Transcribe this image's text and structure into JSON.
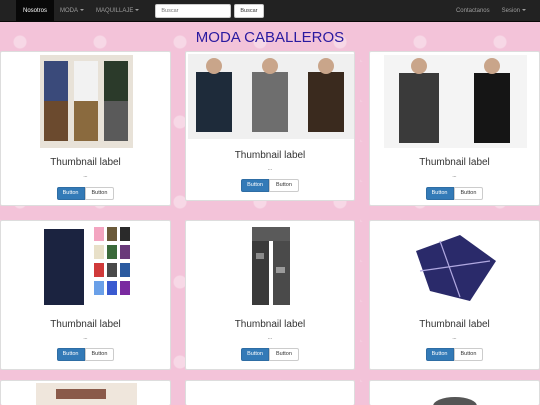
{
  "navbar": {
    "brand": "Nosotros",
    "menu1": "MODA",
    "menu2": "MAQUILLAJE",
    "search_placeholder": "Buscar",
    "search_button": "Buscar",
    "contact": "Contactanos",
    "session": "Sesion"
  },
  "page_title": "MODA CABALLEROS",
  "products": [
    {
      "label": "Thumbnail label",
      "dots": "...",
      "primary": "Button",
      "secondary": "Button"
    },
    {
      "label": "Thumbnail label",
      "dots": "...",
      "primary": "Button",
      "secondary": "Button"
    },
    {
      "label": "Thumbnail label",
      "dots": "...",
      "primary": "Button",
      "secondary": "Button"
    },
    {
      "label": "Thumbnail label",
      "dots": "...",
      "primary": "Button",
      "secondary": "Button"
    },
    {
      "label": "Thumbnail label",
      "dots": "...",
      "primary": "Button",
      "secondary": "Button"
    },
    {
      "label": "Thumbnail label",
      "dots": "...",
      "primary": "Button",
      "secondary": "Button"
    }
  ],
  "colors": {
    "navbar": "#222222",
    "primary": "#337ab7",
    "title": "#2a1aa0",
    "background": "#f3c3d9"
  }
}
